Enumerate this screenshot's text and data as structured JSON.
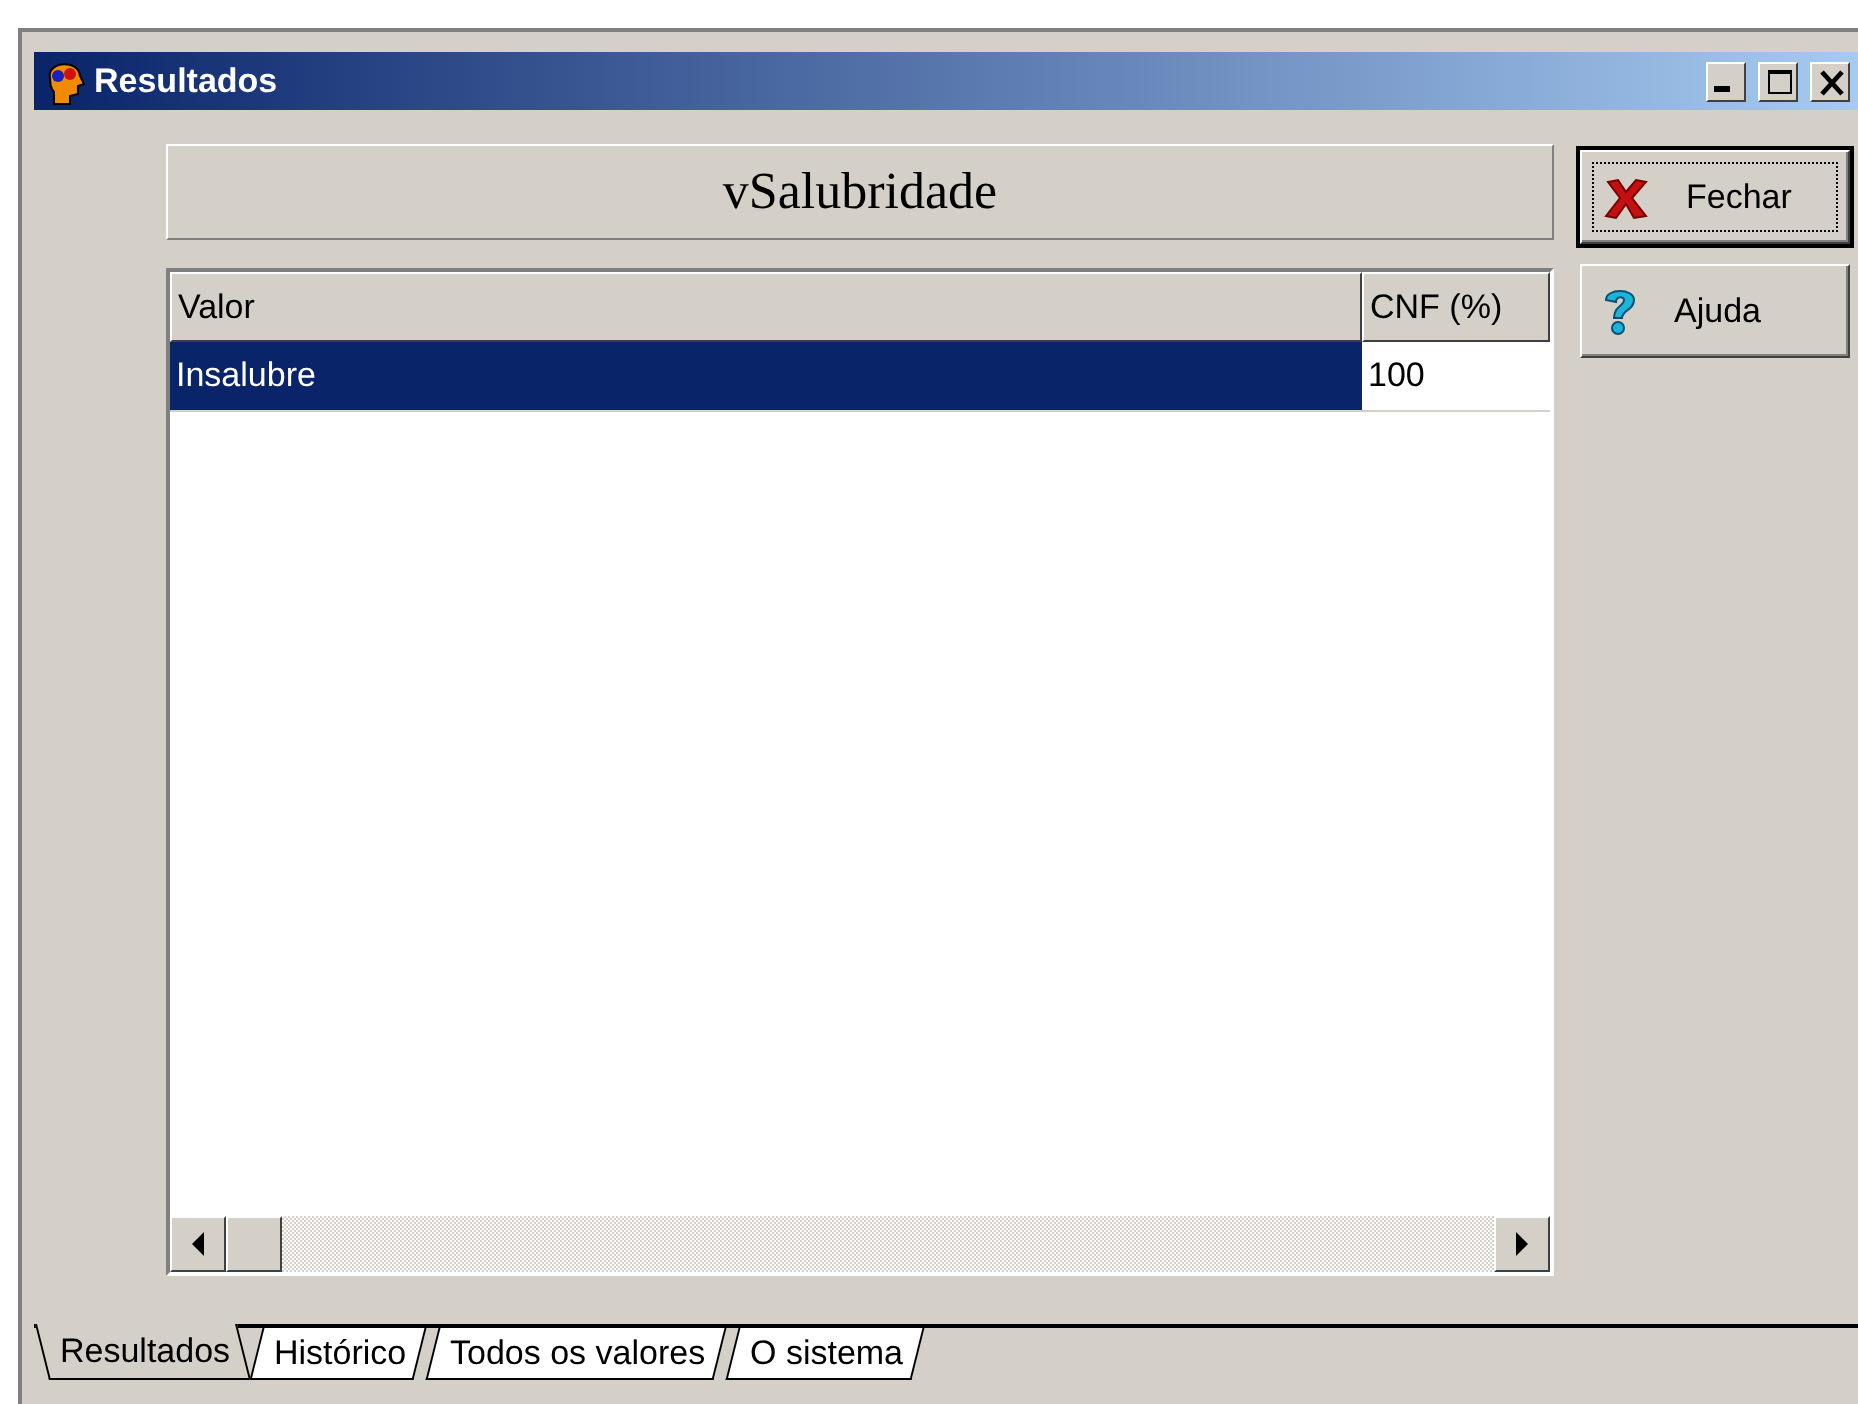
{
  "window": {
    "title": "Resultados"
  },
  "header": {
    "title": "vSalubridade"
  },
  "table": {
    "columns": [
      "Valor",
      "CNF (%)"
    ],
    "rows": [
      {
        "cells": [
          "Insalubre",
          "100"
        ],
        "selected": true
      }
    ]
  },
  "buttons": [
    {
      "label": "Fechar",
      "kind": "close",
      "focused": true
    },
    {
      "label": "Ajuda",
      "kind": "help",
      "focused": false
    }
  ],
  "tabs": [
    {
      "label": "Resultados",
      "selected": true
    },
    {
      "label": "Histórico",
      "selected": false
    },
    {
      "label": "Todos os valores",
      "selected": false
    },
    {
      "label": "O sistema",
      "selected": false
    }
  ]
}
